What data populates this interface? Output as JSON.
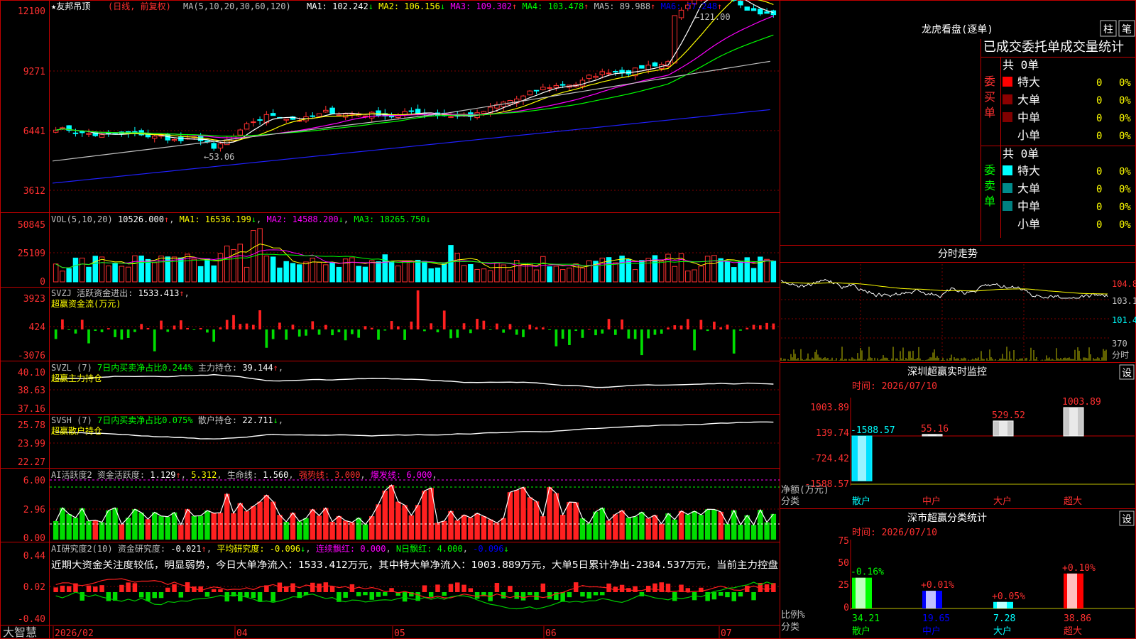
{
  "stock_title": "★友邦吊顶",
  "stock_mode": "(日线, 前复权)",
  "ma_header": {
    "label": "MA(5,10,20,30,60,120)",
    "items": [
      {
        "name": "MA1",
        "value": "102.242",
        "arrow": "↓",
        "color": "#ffffff"
      },
      {
        "name": "MA2",
        "value": "106.156",
        "arrow": "↓",
        "color": "#ffff00"
      },
      {
        "name": "MA3",
        "value": "109.302",
        "arrow": "↑",
        "color": "#ff00ff"
      },
      {
        "name": "MA4",
        "value": "103.478",
        "arrow": "↑",
        "color": "#00ff00"
      },
      {
        "name": "MA5",
        "value": "89.988",
        "arrow": "↑",
        "color": "#c0c0c0"
      },
      {
        "name": "MA6",
        "value": "77.248",
        "arrow": "↑",
        "color": "#0000ff"
      }
    ]
  },
  "price_axis": [
    "12100",
    "9271",
    "6441",
    "3612"
  ],
  "price_high_label": "121.00",
  "price_low_label": "53.06",
  "vol_header": {
    "label": "VOL(5,10,20)",
    "value": "10526.000",
    "ma1": "16536.199",
    "ma2": "14588.200",
    "ma3": "18265.750"
  },
  "vol_axis": [
    "50845",
    "25109",
    "0"
  ],
  "svzj_header": {
    "label": "SVZJ  活跃资金进出:",
    "value": "1533.413",
    "sub": "超赢资金流(万元)"
  },
  "svzj_axis": [
    "3923",
    "424",
    "-3076"
  ],
  "svzl_header": {
    "label": "SVZL (7)",
    "text1": "7日内买卖净占比0.244%",
    "text2": "主力持仓:",
    "value": "39.144",
    "sub": "超赢主力持仓"
  },
  "svzl_axis": [
    "40.10",
    "38.63",
    "37.16"
  ],
  "svsh_header": {
    "label": "SVSH (7)",
    "text1": "7日内买卖净占比0.075%",
    "text2": "散户持仓:",
    "value": "22.711",
    "sub": "超赢散户持仓"
  },
  "svsh_axis": [
    "25.78",
    "23.99",
    "22.27"
  ],
  "ai_header": {
    "label": "AI活跃度2",
    "text1": "资金活跃度:",
    "v1": "1.129",
    "v2": "5.312",
    "text3": "生命线:",
    "v3": "1.560",
    "text4": "强势线:",
    "v4": "3.000",
    "text5": "爆发线:",
    "v5": "6.000"
  },
  "ai_axis": [
    "6.00",
    "2.96",
    "0.00"
  ],
  "ai2_header": {
    "label": "AI研究度2(10)",
    "text1": "资金研究度:",
    "v1": "-0.021",
    "text2": "平均研究度:",
    "v2": "-0.096",
    "text3": "连续飘红:",
    "v3": "0.000",
    "text4": "N日飘红:",
    "v4": "4.000",
    "v5": "-0.096"
  },
  "ai2_comment": "近期大资金关注度较低，明显弱势，今日大单净流入：1533.412万元，其中特大单净流入：1003.889万元，大单5日累计净出-2384.537万元，当前主力控盘",
  "ai2_axis": [
    "0.44",
    "0.02",
    "-0.40"
  ],
  "date_axis": {
    "brand": "大智慧",
    "labels": [
      "2026/02",
      "04",
      "05",
      "06",
      "07"
    ]
  },
  "right_panel": {
    "lhb_title": "龙虎看盘(逐单)",
    "btn_zhu": "柱",
    "btn_bi": "笔",
    "tabs": "已成交委托单成交量统计",
    "buy_label": "委买单",
    "sell_label": "委卖单",
    "buy_total": "共 0单",
    "sell_total": "共 0单",
    "buy_rows": [
      {
        "label": "特大",
        "value": "0",
        "pct": "0%",
        "color": "#ff0000"
      },
      {
        "label": "大单",
        "value": "0",
        "pct": "0%",
        "color": "#8b0000"
      },
      {
        "label": "中单",
        "value": "0",
        "pct": "0%",
        "color": "#800000"
      },
      {
        "label": "小单",
        "value": "0",
        "pct": "0%",
        "color": ""
      }
    ],
    "sell_rows": [
      {
        "label": "特大",
        "value": "0",
        "pct": "0%",
        "color": "#00ffff"
      },
      {
        "label": "大单",
        "value": "0",
        "pct": "0%",
        "color": "#008b8b"
      },
      {
        "label": "中单",
        "value": "0",
        "pct": "0%",
        "color": "#008080"
      },
      {
        "label": "小单",
        "value": "0",
        "pct": "0%",
        "color": ""
      }
    ],
    "fenshi_title": "分时走势",
    "fenshi_axis": [
      "104.8",
      "103.1",
      "101.4"
    ],
    "fenshi_vol_label": "370",
    "fenshi_tag": "分时",
    "sz_title": "深圳超赢实时监控",
    "set_btn": "设",
    "sz_time": "时间: 2026/07/10",
    "sz_axis": [
      "1003.89",
      "139.74",
      "-724.42",
      "-1588.57"
    ],
    "sz_unit": "净额(万元)",
    "sz_cat": "分类",
    "sz_values": [
      "-1588.57",
      "55.16",
      "529.52",
      "1003.89"
    ],
    "sz_categories": [
      "散户",
      "中户",
      "大户",
      "超大"
    ],
    "ss_title": "深市超赢分类统计",
    "ss_time": "时间: 2026/07/10",
    "ss_axis": [
      "75",
      "50",
      "25",
      "0"
    ],
    "ss_unit": "比例%",
    "ss_cat": "分类",
    "ss_top": [
      "-0.16%",
      "+0.01%",
      "+0.05%",
      "+0.10%"
    ],
    "ss_values": [
      "34.21",
      "19.65",
      "7.28",
      "38.86"
    ],
    "ss_categories": [
      "散户",
      "中户",
      "大户",
      "超大"
    ]
  }
}
